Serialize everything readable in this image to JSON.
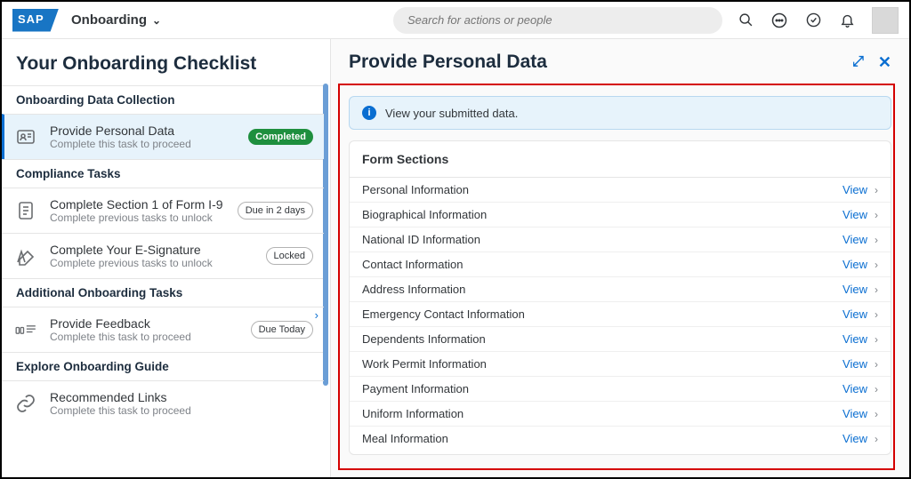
{
  "header": {
    "app_name": "Onboarding",
    "search_placeholder": "Search for actions or people"
  },
  "sidebar": {
    "title": "Your Onboarding Checklist",
    "sections": {
      "data_collection": {
        "label": "Onboarding Data Collection",
        "task": {
          "title": "Provide Personal Data",
          "sub": "Complete this task to proceed",
          "badge": "Completed"
        }
      },
      "compliance": {
        "label": "Compliance Tasks",
        "task1": {
          "title": "Complete Section 1 of Form I-9",
          "sub": "Complete previous tasks to unlock",
          "badge": "Due in 2 days"
        },
        "task2": {
          "title": "Complete Your E-Signature",
          "sub": "Complete previous tasks to unlock",
          "badge": "Locked"
        }
      },
      "additional": {
        "label": "Additional Onboarding Tasks",
        "task": {
          "title": "Provide Feedback",
          "sub": "Complete this task to proceed",
          "badge": "Due Today"
        }
      },
      "explore": {
        "label": "Explore Onboarding Guide",
        "task": {
          "title": "Recommended Links",
          "sub": "Complete this task to proceed"
        }
      }
    }
  },
  "main": {
    "title": "Provide Personal Data",
    "info": "View your submitted data.",
    "panel_title": "Form Sections",
    "view": "View",
    "sections": [
      "Personal Information",
      "Biographical Information",
      "National ID Information",
      "Contact Information",
      "Address Information",
      "Emergency Contact Information",
      "Dependents Information",
      "Work Permit Information",
      "Payment Information",
      "Uniform Information",
      "Meal Information"
    ]
  }
}
